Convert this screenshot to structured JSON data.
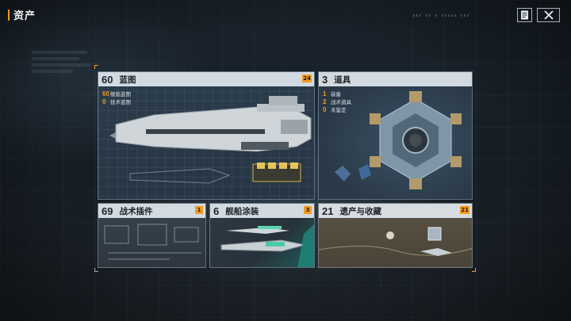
{
  "header": {
    "title": "资产",
    "notes_icon": "notes-icon",
    "close_icon": "close-icon"
  },
  "colors": {
    "accent": "#f39a1e",
    "card_header": "#e1e8ee",
    "background": "#1a232c"
  },
  "cards": {
    "blueprints": {
      "count": "60",
      "name": "蓝图",
      "badge": "24",
      "items": [
        {
          "count": "60",
          "label": "舰船蓝图"
        },
        {
          "count": "0",
          "label": "技术蓝图"
        }
      ]
    },
    "items": {
      "count": "3",
      "name": "道具",
      "items": [
        {
          "count": "1",
          "label": "装备"
        },
        {
          "count": "2",
          "label": "战术道具"
        },
        {
          "count": "0",
          "label": "未鉴定"
        }
      ]
    },
    "plugins": {
      "count": "69",
      "name": "战术插件",
      "badge": "1"
    },
    "paint": {
      "count": "6",
      "name": "舰船涂装",
      "badge": "3"
    },
    "legacy": {
      "count": "21",
      "name": "遗产与收藏",
      "badge": "21"
    }
  }
}
